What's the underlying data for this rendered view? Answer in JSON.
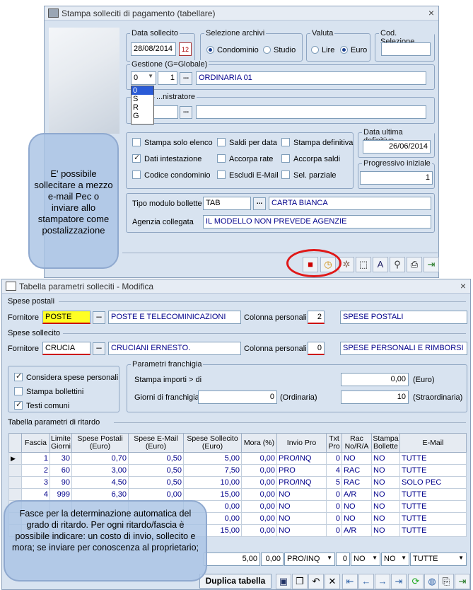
{
  "top_window": {
    "title": "Stampa solleciti di pagamento (tabellare)",
    "data_sollecito": {
      "label": "Data sollecito",
      "value": "28/08/2014"
    },
    "selezione_archivi": {
      "label": "Selezione archivi",
      "options": [
        "Condominio",
        "Studio"
      ]
    },
    "valuta": {
      "label": "Valuta",
      "options": [
        "Lire",
        "Euro"
      ]
    },
    "cod_selezione": {
      "label": "Cod. Selezione",
      "value": ""
    },
    "gestione": {
      "label": "Gestione (G=Globale)",
      "type_value": "0",
      "number": "1",
      "desc": "ORDINARIA 01",
      "dropdown": [
        "0",
        "S",
        "R",
        "G"
      ]
    },
    "amministratore": {
      "label": "...nistratore"
    },
    "checks": [
      {
        "label": "Stampa solo elenco",
        "checked": false
      },
      {
        "label": "Saldi per data",
        "checked": false
      },
      {
        "label": "Stampa definitiva",
        "checked": false
      },
      {
        "label": "Dati intestazione",
        "checked": true
      },
      {
        "label": "Accorpa rate",
        "checked": false
      },
      {
        "label": "Accorpa saldi",
        "checked": false
      },
      {
        "label": "Codice condominio",
        "checked": false
      },
      {
        "label": "Escludi E-Mail",
        "checked": false
      },
      {
        "label": "Sel. parziale",
        "checked": false
      }
    ],
    "data_ultima": {
      "label": "Data ultima definitiva",
      "value": "26/06/2014"
    },
    "progressivo": {
      "label": "Progressivo iniziale",
      "value": "1"
    },
    "tipo_modulo": {
      "label": "Tipo modulo bollette",
      "code": "TAB",
      "desc": "CARTA BIANCA"
    },
    "agenzia": {
      "label": "Agenzia collegata",
      "desc": "IL MODELLO NON PREVEDE AGENZIE"
    }
  },
  "bubble_top": "E' possibile sollecitare a mezzo e-mail Pec o inviare allo stampatore come postalizzazione",
  "bottom_window": {
    "title": "Tabella parametri solleciti - Modifica",
    "spese_postali": {
      "label": "Spese postali",
      "fornitore_label": "Fornitore",
      "code": "POSTE",
      "desc": "POSTE E TELECOMINICAZIONI",
      "col_label": "Colonna personali",
      "col": "2",
      "col_desc": "SPESE POSTALI"
    },
    "spese_sollecito": {
      "label": "Spese sollecito",
      "fornitore_label": "Fornitore",
      "code": "CRUCIA",
      "desc": "CRUCIANI ERNESTO.",
      "col_label": "Colonna personali",
      "col": "0",
      "col_desc": "SPESE PERSONALI E RIMBORSI"
    },
    "options": [
      {
        "label": "Considera spese personali",
        "checked": true
      },
      {
        "label": "Stampa bollettini",
        "checked": false
      },
      {
        "label": "Testi comuni",
        "checked": true
      }
    ],
    "franchigia": {
      "label": "Parametri franchigia",
      "importi_label": "Stampa importi > di",
      "importi": "0,00",
      "unit1": "(Euro)",
      "giorni_label": "Giorni di franchigia",
      "ordinaria": "0",
      "ord_label": "(Ordinaria)",
      "straordinaria": "10",
      "straord_label": "(Straordinaria)"
    },
    "table_label": "Tabella parametri di ritardo",
    "headers": [
      "Fascia",
      "Limite Giorni",
      "Spese Postali (Euro)",
      "Spese E-Mail (Euro)",
      "Spese Sollecito (Euro)",
      "Mora (%)",
      "Invio Pro",
      "Txt Pro",
      "Rac No/R/A",
      "Stampa Bollette",
      "E-Mail"
    ],
    "rows": [
      [
        "1",
        "30",
        "0,70",
        "0,50",
        "5,00",
        "0,00",
        "PRO/INQ",
        "0",
        "NO",
        "NO",
        "TUTTE"
      ],
      [
        "2",
        "60",
        "3,00",
        "0,50",
        "7,50",
        "0,00",
        "PRO",
        "4",
        "RAC",
        "NO",
        "TUTTE"
      ],
      [
        "3",
        "90",
        "4,50",
        "0,50",
        "10,00",
        "0,00",
        "PRO/INQ",
        "5",
        "RAC",
        "NO",
        "SOLO PEC"
      ],
      [
        "4",
        "999",
        "6,30",
        "0,00",
        "15,00",
        "0,00",
        "NO",
        "0",
        "A/R",
        "NO",
        "TUTTE"
      ],
      [
        "",
        "",
        "",
        "",
        "0,00",
        "0,00",
        "NO",
        "0",
        "NO",
        "NO",
        "TUTTE"
      ],
      [
        "",
        "",
        "",
        "",
        "0,00",
        "0,00",
        "NO",
        "0",
        "NO",
        "NO",
        "TUTTE"
      ],
      [
        "",
        "",
        "",
        "",
        "15,00",
        "0,00",
        "NO",
        "0",
        "A/R",
        "NO",
        "TUTTE"
      ]
    ],
    "edit_row": {
      "sollecito": "5,00",
      "mora": "0,00",
      "invio": "PRO/INQ",
      "txt": "0",
      "rac": "NO",
      "stampa": "NO",
      "email": "TUTTE"
    },
    "duplica": "Duplica tabella"
  },
  "bubble_bottom": "Fasce per la determinazione automatica del grado di ritardo. Per ogni ritardo/fascia è possibile indicare: un costo di invio, sollecito e mora; se inviare per conoscenza al proprietario;"
}
